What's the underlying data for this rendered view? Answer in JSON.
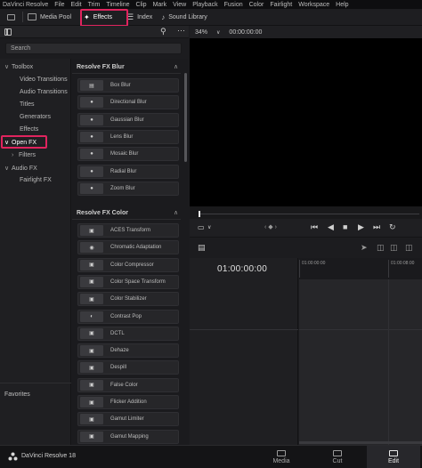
{
  "menu": [
    "DaVinci Resolve",
    "File",
    "Edit",
    "Trim",
    "Timeline",
    "Clip",
    "Mark",
    "View",
    "Playback",
    "Fusion",
    "Color",
    "Fairlight",
    "Workspace",
    "Help"
  ],
  "toolbar": {
    "media_pool": "Media Pool",
    "effects": "Effects",
    "index": "Index",
    "sound_library": "Sound Library"
  },
  "search": {
    "placeholder": "Search"
  },
  "tree": {
    "toolbox": "Toolbox",
    "video_transitions": "Video Transitions",
    "audio_transitions": "Audio Transitions",
    "titles": "Titles",
    "generators": "Generators",
    "effects": "Effects",
    "open_fx": "Open FX",
    "filters": "Filters",
    "audio_fx": "Audio FX",
    "fairlight_fx": "Fairlight FX",
    "favorites": "Favorites"
  },
  "fx_blur": {
    "header": "Resolve FX Blur",
    "items": [
      "Box Blur",
      "Directional Blur",
      "Gaussian Blur",
      "Lens Blur",
      "Mosaic Blur",
      "Radial Blur",
      "Zoom Blur"
    ]
  },
  "fx_color": {
    "header": "Resolve FX Color",
    "items": [
      "ACES Transform",
      "Chromatic Adaptation",
      "Color Compressor",
      "Color Space Transform",
      "Color Stabilizer",
      "Contrast Pop",
      "DCTL",
      "Dehaze",
      "Despill",
      "False Color",
      "Flicker Addition",
      "Gamut Limiter",
      "Gamut Mapping"
    ]
  },
  "viewer": {
    "zoom": "34%",
    "timecode": "00:00:00:00"
  },
  "timeline": {
    "timecode": "01:00:00:00",
    "ruler_labels": [
      "01:00:00:00",
      "01:00:08:00"
    ]
  },
  "bottom": {
    "app_name": "DaVinci Resolve 18",
    "tabs": [
      "Media",
      "Cut",
      "Edit"
    ],
    "active_tab": "Edit"
  },
  "colors": {
    "highlight": "#e0245e",
    "panel": "#1f1f22",
    "viewer": "#000000"
  }
}
